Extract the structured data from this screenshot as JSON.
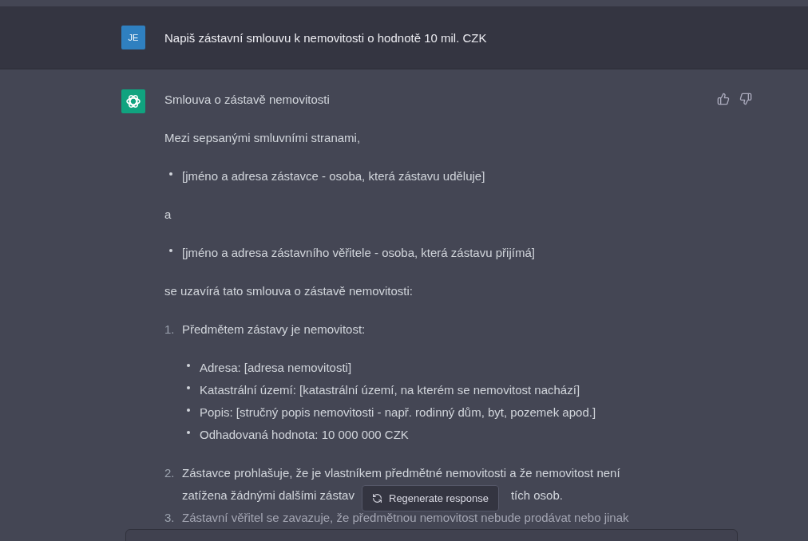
{
  "user_message": {
    "avatar": "JE",
    "text": "Napiš zástavní smlouvu k nemovitosti o hodnotě 10 mil. CZK"
  },
  "assistant_message": {
    "title": "Smlouva o zástavě nemovitosti",
    "blocks": [
      {
        "kind": "paragraph",
        "text": "Mezi sepsanými smluvními stranami,"
      },
      {
        "kind": "bullets",
        "items": [
          "[jméno a adresa zástavce - osoba, která zástavu uděluje]"
        ]
      },
      {
        "kind": "paragraph",
        "text": "a"
      },
      {
        "kind": "bullets",
        "items": [
          "[jméno a adresa zástavního věřitele - osoba, která zástavu přijímá]"
        ]
      },
      {
        "kind": "paragraph",
        "text": "se uzavírá tato smlouva o zástavě nemovitosti:"
      },
      {
        "kind": "numbered",
        "items": [
          {
            "number": "1.",
            "lines": [
              [
                "Předmětem zástavy je nemovitost:"
              ]
            ],
            "children": [
              "Adresa: [adresa nemovitosti]",
              "Katastrální území: [katastrální území, na kterém se nemovitost nachází]",
              "Popis: [stručný popis nemovitosti - např. rodinný dům, byt, pozemek apod.]",
              "Odhadovaná hodnota: 10 000 000 CZK"
            ]
          },
          {
            "number": "2.",
            "lines": [
              [
                "Zástavce prohlašuje, že je vlastníkem předmětné nemovitosti a že nemovitost není"
              ],
              [
                "zatížena žádnými dalšími zástav",
                "tích osob."
              ]
            ]
          },
          {
            "number": "3.",
            "lines": [
              [
                "Zástavní věřitel se zavazuje, že předmětnou nemovitost nebude prodávat nebo jinak"
              ]
            ],
            "faded": true
          }
        ]
      }
    ]
  },
  "regenerate_button": {
    "label": "Regenerate response"
  }
}
